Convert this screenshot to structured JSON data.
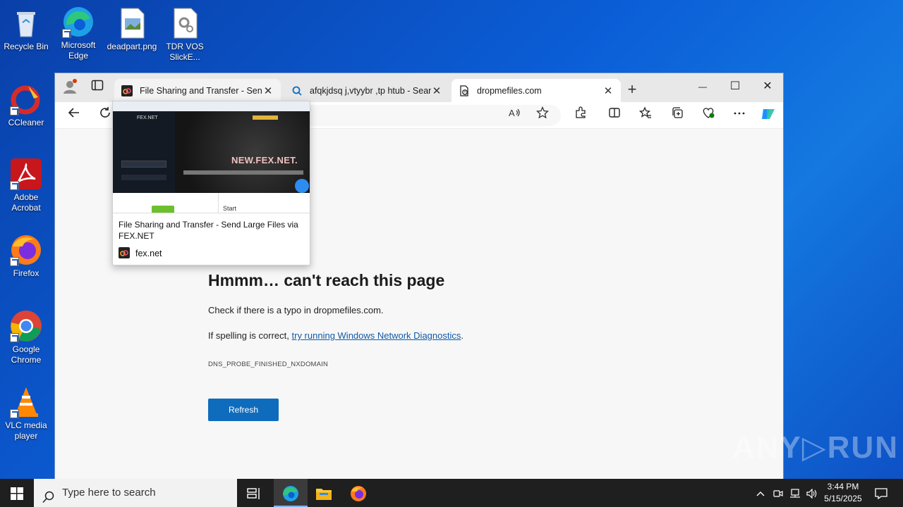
{
  "desktop": {
    "icons": [
      {
        "label": "Recycle Bin"
      },
      {
        "label": "Microsoft Edge"
      },
      {
        "label": "deadpart.png"
      },
      {
        "label": "TDR VOS SlickE..."
      },
      {
        "label": "CCleaner"
      },
      {
        "label": "Adobe Acrobat"
      },
      {
        "label": "Firefox"
      },
      {
        "label": "Google Chrome"
      },
      {
        "label": "VLC media player"
      }
    ]
  },
  "browser": {
    "tabs": [
      {
        "title": "File Sharing and Transfer - Send L",
        "close": "✕"
      },
      {
        "title": "afqkjdsq j,vtyybr ,tp htub - Searc",
        "close": "✕"
      },
      {
        "title": "dropmefiles.com",
        "close": "✕"
      }
    ],
    "new_tab": "+",
    "window_controls": {
      "minimize": "—",
      "maximize": "☐",
      "close": "✕"
    }
  },
  "error_page": {
    "title": "Hmmm… can't reach this page",
    "line1": "Check if there is a typo in dropmefiles.com.",
    "line2_prefix": "If spelling is correct, ",
    "line2_link": "try running Windows Network Diagnostics",
    "line2_suffix": ".",
    "code": "DNS_PROBE_FINISHED_NXDOMAIN",
    "refresh_label": "Refresh"
  },
  "hover_card": {
    "title": "File Sharing and Transfer - Send Large Files via FEX.NET",
    "host": "fex.net",
    "thumb_brand": "FEX.NET",
    "thumb_hero": "NEW.FEX.NET.",
    "thumb_start": "Start"
  },
  "taskbar": {
    "search_placeholder": "Type here to search",
    "time": "3:44 PM",
    "date": "5/15/2025"
  },
  "watermark": "ANY▷RUN"
}
